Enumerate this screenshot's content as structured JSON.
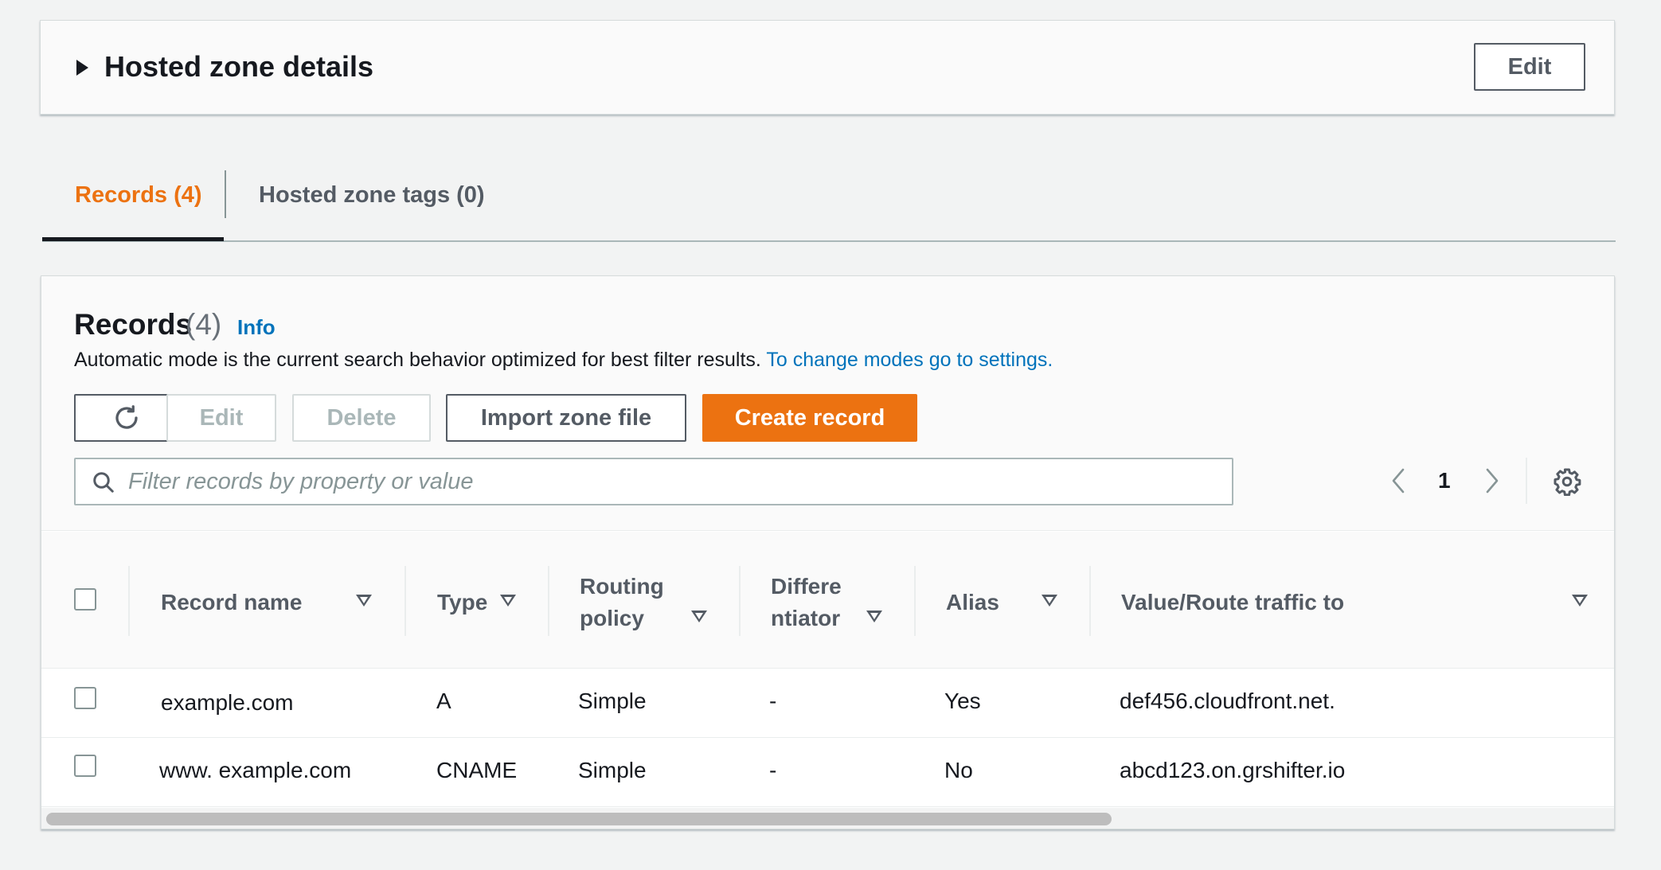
{
  "hosted_zone": {
    "title": "Hosted zone details",
    "edit_label": "Edit"
  },
  "tabs": [
    {
      "label": "Records (4)",
      "active": true
    },
    {
      "label": "Hosted zone tags (0)",
      "active": false
    }
  ],
  "records": {
    "title": "Records",
    "count": "(4)",
    "info_label": "Info",
    "description": "Automatic mode is the current search behavior optimized for best filter results.",
    "settings_link": "To change modes go to settings.",
    "toolbar": {
      "refresh_icon": "refresh-icon",
      "edit_label": "Edit",
      "delete_label": "Delete",
      "import_label": "Import zone file",
      "create_label": "Create record"
    },
    "search": {
      "placeholder": "Filter records by property or value"
    },
    "pagination": {
      "page": "1"
    },
    "columns": {
      "record_name": "Record name",
      "type": "Type",
      "routing_line1": "Routing",
      "routing_line2": "policy",
      "diff_line1": "Differe",
      "diff_line2": "ntiator",
      "alias": "Alias",
      "value": "Value/Route traffic to"
    },
    "rows": [
      {
        "record_name": "example.com",
        "type": "A",
        "routing": "Simple",
        "differentiator": "-",
        "alias": "Yes",
        "value": "def456.cloudfront.net."
      },
      {
        "record_name": "www. example.com",
        "type": "CNAME",
        "routing": "Simple",
        "differentiator": "-",
        "alias": "No",
        "value": "abcd123.on.grshifter.io"
      }
    ]
  },
  "colors": {
    "accent": "#ec7211",
    "link": "#0073bb",
    "text": "#16191f",
    "muted": "#545b64"
  }
}
